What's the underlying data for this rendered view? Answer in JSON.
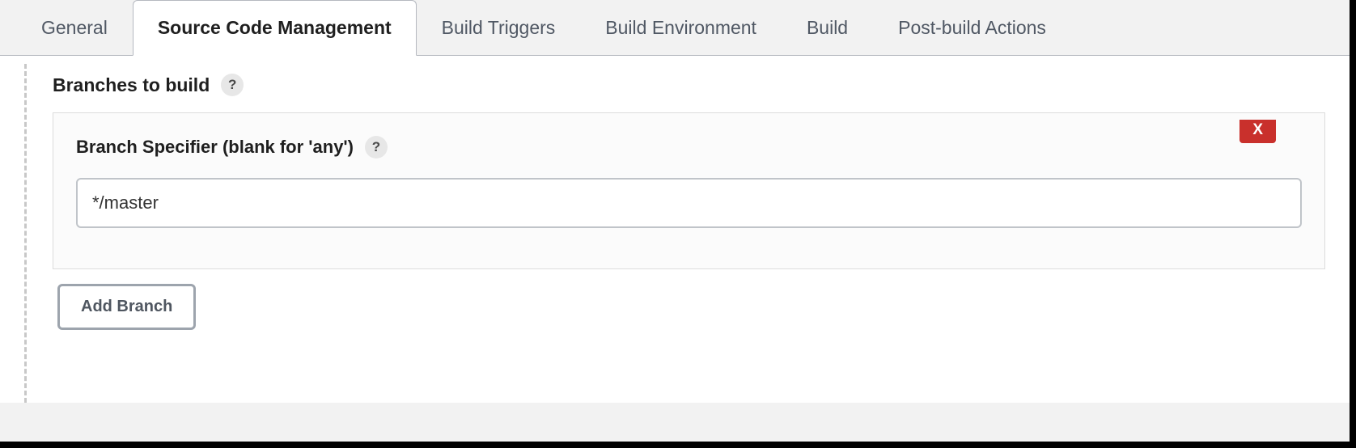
{
  "tabs": [
    {
      "label": "General"
    },
    {
      "label": "Source Code Management"
    },
    {
      "label": "Build Triggers"
    },
    {
      "label": "Build Environment"
    },
    {
      "label": "Build"
    },
    {
      "label": "Post-build Actions"
    }
  ],
  "section": {
    "title": "Branches to build",
    "help_glyph": "?"
  },
  "branch_specifier": {
    "label": "Branch Specifier (blank for 'any')",
    "help_glyph": "?",
    "value": "*/master"
  },
  "buttons": {
    "delete_label": "X",
    "add_branch_label": "Add Branch"
  }
}
